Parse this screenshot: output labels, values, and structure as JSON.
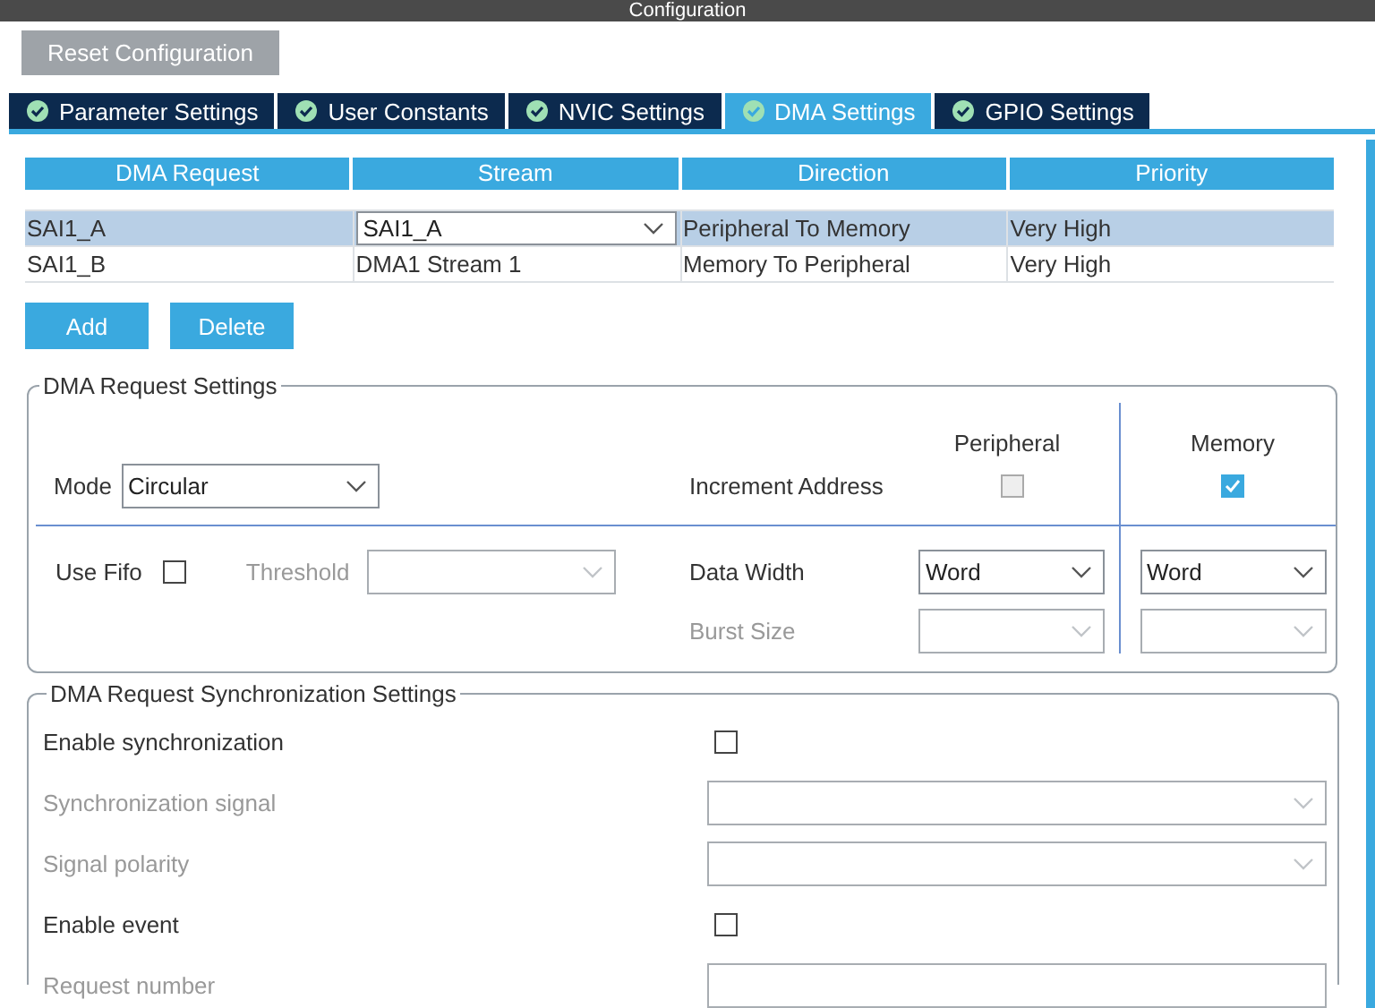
{
  "window": {
    "title": "Configuration"
  },
  "reset_button": "Reset Configuration",
  "tabs": [
    {
      "label": "Parameter Settings",
      "selected": false
    },
    {
      "label": "User Constants",
      "selected": false
    },
    {
      "label": "NVIC Settings",
      "selected": false
    },
    {
      "label": "DMA Settings",
      "selected": true
    },
    {
      "label": "GPIO Settings",
      "selected": false
    }
  ],
  "table": {
    "columns": [
      "DMA Request",
      "Stream",
      "Direction",
      "Priority"
    ],
    "rows": [
      {
        "selected": true,
        "cells": [
          {
            "kind": "text",
            "text": "SAI1_A"
          },
          {
            "kind": "dropdown",
            "text": "SAI1_A"
          },
          {
            "kind": "text",
            "text": "Peripheral To Memory"
          },
          {
            "kind": "text",
            "text": "Very High"
          }
        ]
      },
      {
        "selected": false,
        "cells": [
          {
            "kind": "text",
            "text": "SAI1_B"
          },
          {
            "kind": "text",
            "text": "DMA1 Stream 1"
          },
          {
            "kind": "text",
            "text": "Memory To Peripheral"
          },
          {
            "kind": "text",
            "text": "Very High"
          }
        ]
      }
    ]
  },
  "buttons": [
    "Add",
    "Delete"
  ],
  "request_settings": {
    "title": "DMA Request Settings",
    "column_headers": [
      "Peripheral",
      "Memory"
    ],
    "mode": {
      "label": "Mode",
      "value": "Circular"
    },
    "increment_address": {
      "label": "Increment Address",
      "peripheral": {
        "checked": false,
        "disabled": true
      },
      "memory": {
        "checked": true,
        "disabled": false
      }
    },
    "use_fifo": {
      "label": "Use Fifo",
      "checked": false
    },
    "threshold": {
      "label": "Threshold",
      "disabled": true
    },
    "data_width": {
      "label": "Data Width",
      "peripheral": "Word",
      "memory": "Word"
    },
    "burst_size": {
      "label": "Burst Size",
      "disabled": true
    }
  },
  "sync_settings": {
    "title": "DMA Request Synchronization Settings",
    "rows": [
      {
        "kind": "checkbox",
        "label": "Enable synchronization",
        "checked": false,
        "disabled": false
      },
      {
        "kind": "dropdown",
        "label": "Synchronization signal",
        "disabled": true
      },
      {
        "kind": "dropdown",
        "label": "Signal polarity",
        "disabled": true
      },
      {
        "kind": "checkbox",
        "label": "Enable event",
        "checked": false,
        "disabled": false
      },
      {
        "kind": "input",
        "label": "Request number",
        "disabled": true
      }
    ]
  }
}
